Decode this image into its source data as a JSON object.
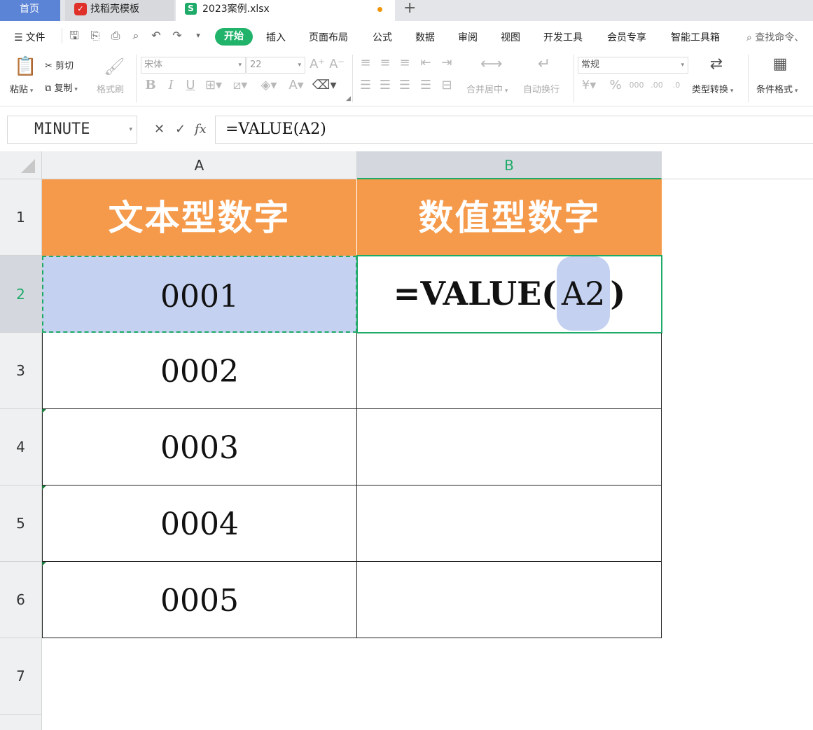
{
  "tabs": {
    "home": "首页",
    "template": "找稻壳模板",
    "workbook": "2023案例.xlsx",
    "add": "+"
  },
  "menu": {
    "file": "文件",
    "items": [
      "开始",
      "插入",
      "页面布局",
      "公式",
      "数据",
      "审阅",
      "视图",
      "开发工具",
      "会员专享",
      "智能工具箱"
    ],
    "search": "查找命令、"
  },
  "ribbon": {
    "paste": "粘贴",
    "cut": "剪切",
    "copy": "复制",
    "format_painter": "格式刷",
    "font_name": "宋体",
    "font_size": "22",
    "merge_center": "合并居中",
    "wrap_text": "自动换行",
    "number_format": "常规",
    "type_convert": "类型转换",
    "conditional_format": "条件格式"
  },
  "formula_bar": {
    "name_box": "MINUTE",
    "formula": "=VALUE(A2)"
  },
  "sheet": {
    "columns": [
      "A",
      "B"
    ],
    "rows": [
      "1",
      "2",
      "3",
      "4",
      "5",
      "6",
      "7"
    ],
    "header_a": "文本型数字",
    "header_b": "数值型数字",
    "values_a": [
      "0001",
      "0002",
      "0003",
      "0004",
      "0005"
    ],
    "b2_formula_prefix": "=VALUE(",
    "b2_ref": "A2",
    "b2_formula_suffix": ")"
  },
  "colors": {
    "header_fill": "#f59a4b",
    "selection_fill": "#c4d1f0",
    "accent_green": "#1eaa68",
    "home_tab": "#5b83d6"
  }
}
